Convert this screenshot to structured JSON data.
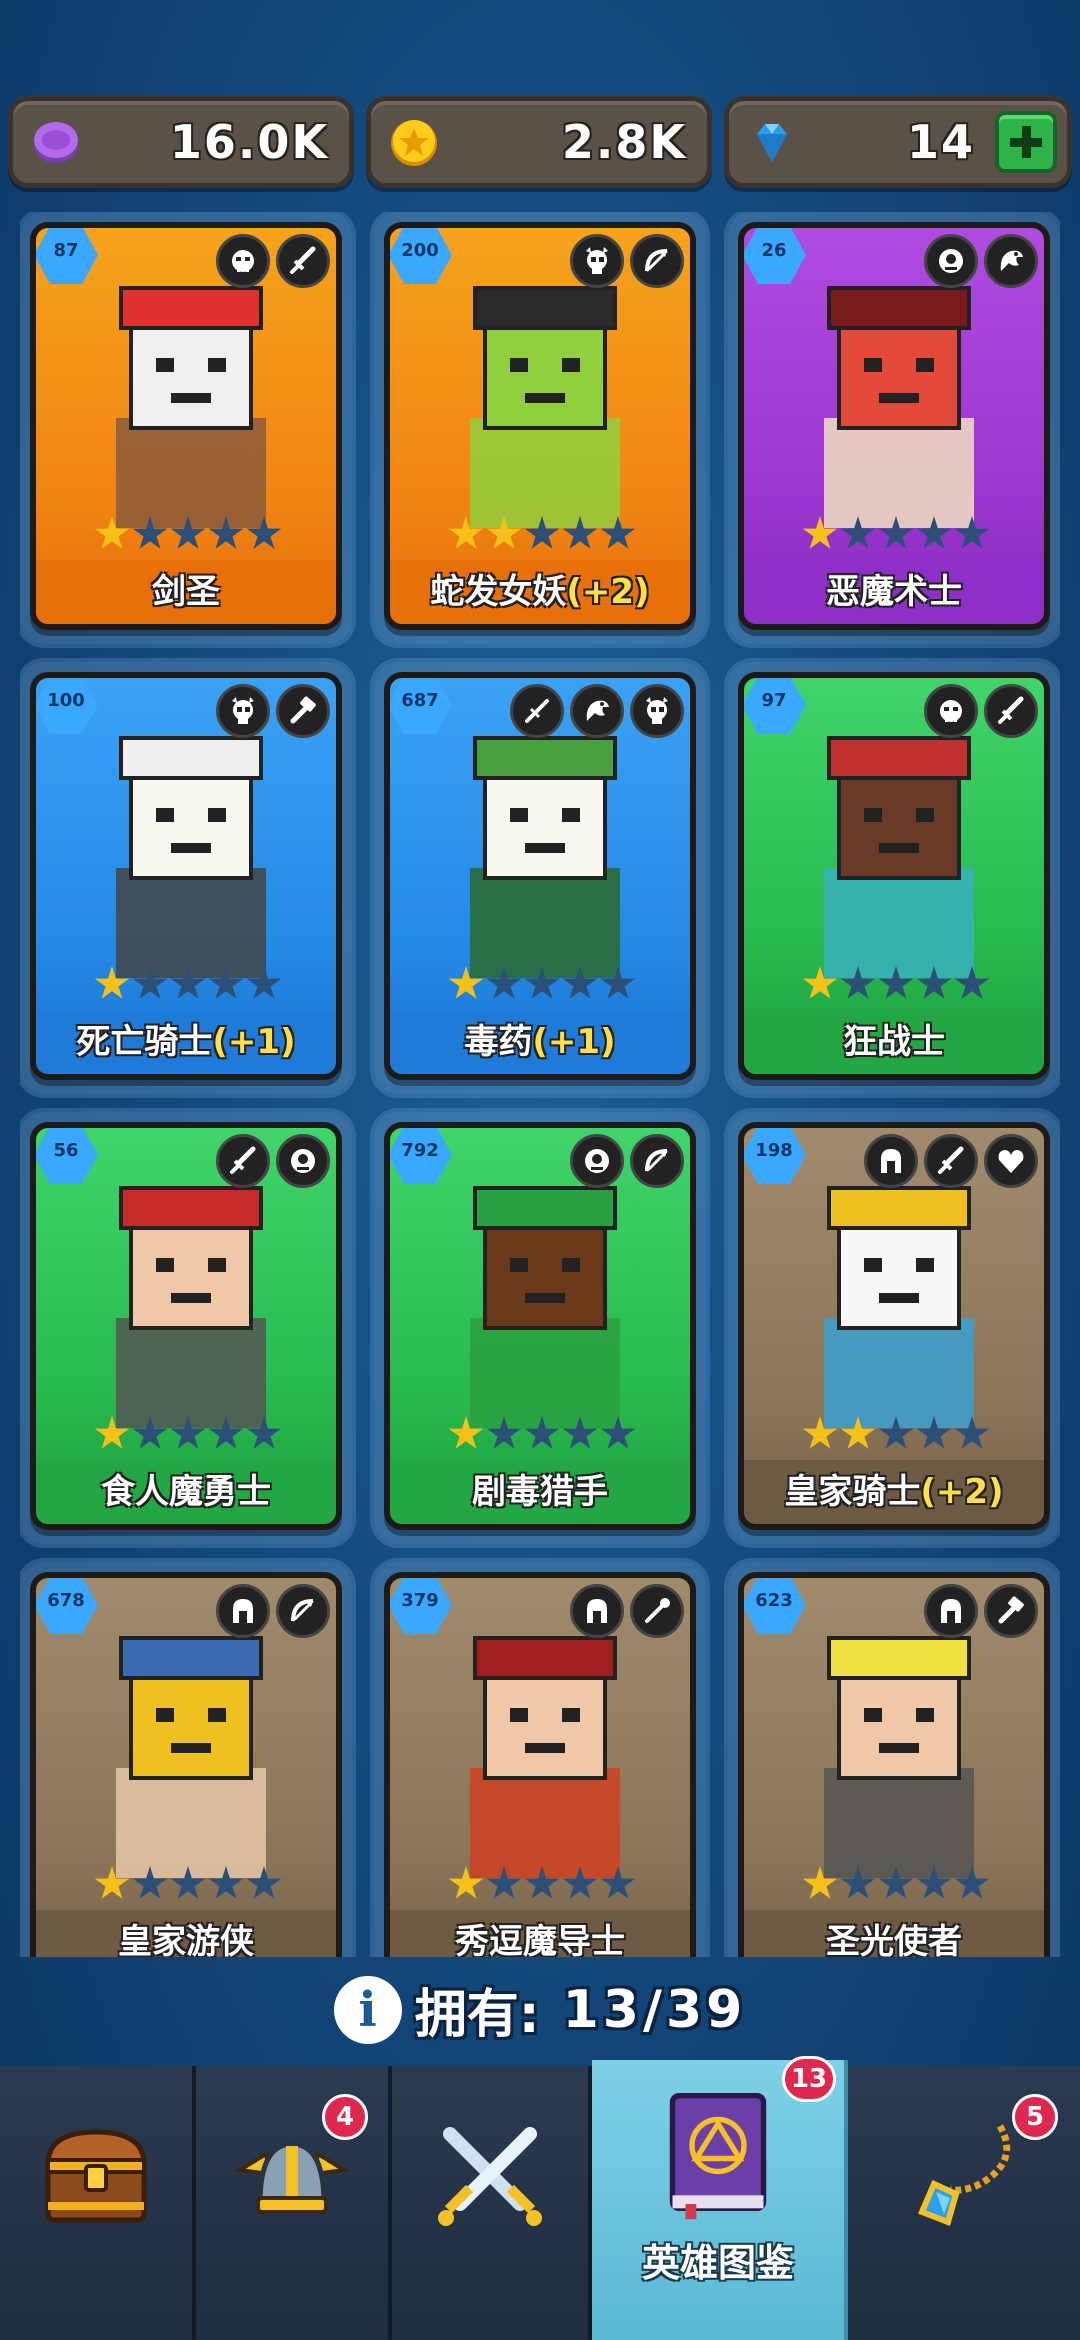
{
  "currencies": {
    "elixir": {
      "value": "16.0K",
      "icon": "purple-elixir-icon"
    },
    "gold": {
      "value": "2.8K",
      "icon": "gold-coin-icon"
    },
    "gems": {
      "value": "14",
      "icon": "blue-gem-icon"
    }
  },
  "heroes": [
    {
      "name": "剑圣",
      "bonus": "",
      "level": "87",
      "stars": 1,
      "rarity": "orange",
      "badges": [
        "orc-icon",
        "sword-icon"
      ]
    },
    {
      "name": "蛇发女妖",
      "bonus": "(+2)",
      "level": "200",
      "stars": 2,
      "rarity": "orange",
      "badges": [
        "skull-icon",
        "bow-icon"
      ]
    },
    {
      "name": "恶魔术士",
      "bonus": "",
      "level": "26",
      "stars": 1,
      "rarity": "purple",
      "badges": [
        "cyclops-icon",
        "dragon-icon"
      ]
    },
    {
      "name": "死亡骑士",
      "bonus": "(+1)",
      "level": "100",
      "stars": 1,
      "rarity": "blue",
      "badges": [
        "skull-icon",
        "hammer-icon"
      ]
    },
    {
      "name": "毒药",
      "bonus": "(+1)",
      "level": "687",
      "stars": 1,
      "rarity": "blue",
      "badges": [
        "dagger-icon",
        "dragon-icon",
        "skull-icon"
      ]
    },
    {
      "name": "狂战士",
      "bonus": "",
      "level": "97",
      "stars": 1,
      "rarity": "green",
      "badges": [
        "orc-icon",
        "sword-icon"
      ]
    },
    {
      "name": "食人魔勇士",
      "bonus": "",
      "level": "56",
      "stars": 1,
      "rarity": "green",
      "badges": [
        "sword-icon",
        "cyclops-icon"
      ]
    },
    {
      "name": "剧毒猎手",
      "bonus": "",
      "level": "792",
      "stars": 1,
      "rarity": "green",
      "badges": [
        "cyclops-icon",
        "bow-icon"
      ]
    },
    {
      "name": "皇家骑士",
      "bonus": "(+2)",
      "level": "198",
      "stars": 2,
      "rarity": "brown",
      "badges": [
        "helmet-icon",
        "sword-icon",
        "heart-icon"
      ]
    },
    {
      "name": "皇家游侠",
      "bonus": "",
      "level": "678",
      "stars": 1,
      "rarity": "brown",
      "badges": [
        "helmet-icon",
        "bow-icon"
      ]
    },
    {
      "name": "秀逗魔导士",
      "bonus": "",
      "level": "379",
      "stars": 1,
      "rarity": "brown",
      "badges": [
        "helmet-icon",
        "staff-icon"
      ]
    },
    {
      "name": "圣光使者",
      "bonus": "",
      "level": "623",
      "stars": 1,
      "rarity": "brown",
      "badges": [
        "helmet-icon",
        "hammer-icon"
      ]
    }
  ],
  "owned": {
    "label": "拥有:",
    "count": "13/39",
    "icon": "info-icon"
  },
  "nav": [
    {
      "id": "shop",
      "icon": "treasure-chest-icon",
      "label": "",
      "badge": "",
      "active": false
    },
    {
      "id": "heroes",
      "icon": "viking-helmet-icon",
      "label": "",
      "badge": "4",
      "active": false
    },
    {
      "id": "battle",
      "icon": "crossed-swords-icon",
      "label": "",
      "badge": "",
      "active": false
    },
    {
      "id": "codex",
      "icon": "spellbook-icon",
      "label": "英雄图鉴",
      "badge": "13",
      "active": true
    },
    {
      "id": "items",
      "icon": "amulet-icon",
      "label": "",
      "badge": "5",
      "active": false
    }
  ],
  "colors": {
    "orange": "#f08412",
    "purple": "#9a36cf",
    "blue": "#2488e6",
    "green": "#27b84c",
    "brown": "#8b7558",
    "star_on": "#f5c018",
    "star_off": "#2c4f78",
    "bonus": "#ffe04a"
  }
}
